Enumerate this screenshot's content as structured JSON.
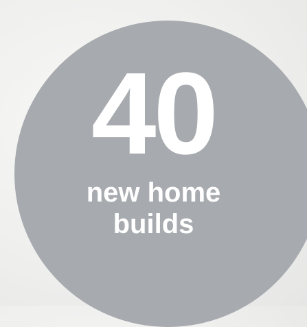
{
  "stat": {
    "number": "40",
    "caption_line1": "new home",
    "caption_line2": "builds"
  },
  "colors": {
    "circle": "#a7aaae",
    "text": "#ffffff",
    "background": "#efefee"
  }
}
